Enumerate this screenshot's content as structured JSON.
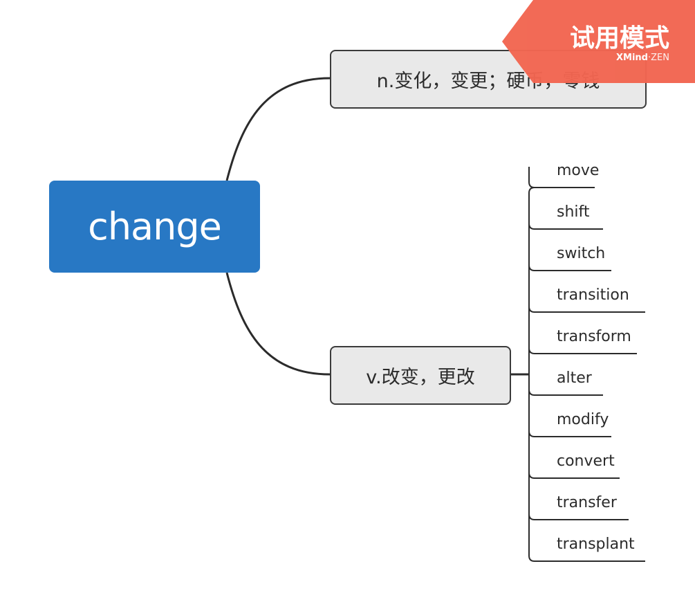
{
  "root": {
    "label": "change"
  },
  "branches": {
    "noun": {
      "label": "n.变化，变更；硬币，零钱"
    },
    "verb": {
      "label": "v.改变，更改"
    }
  },
  "synonyms": [
    "move",
    "shift",
    "switch",
    "transition",
    "transform",
    "alter",
    "modify",
    "convert",
    "transfer",
    "transplant"
  ],
  "trial_badge": {
    "title": "试用模式",
    "brand": "XMind",
    "brand_sep": "·",
    "brand_suffix": "ZEN"
  },
  "colors": {
    "root_fill": "#2878c4",
    "branch_fill": "#e9e9e9",
    "line": "#2b2b2b",
    "badge": "#f26651"
  }
}
